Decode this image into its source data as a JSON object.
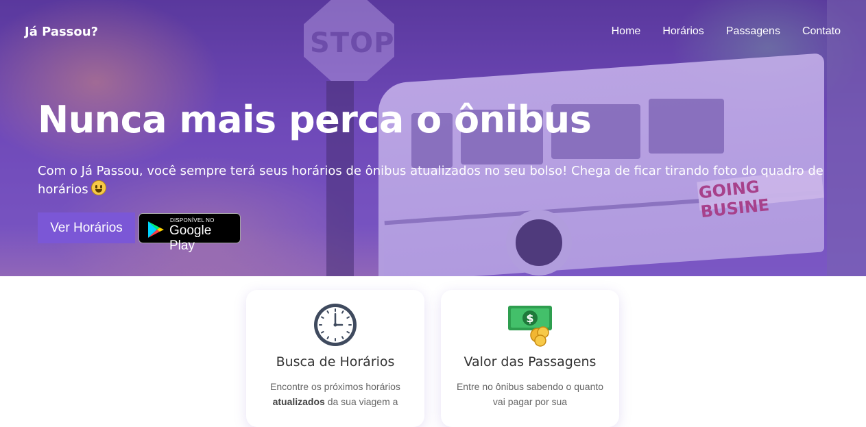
{
  "brand": "Já Passou?",
  "nav": {
    "items": [
      "Home",
      "Horários",
      "Passagens",
      "Contato"
    ]
  },
  "hero": {
    "title": "Nunca mais perca o ônibus",
    "subtitle": "Com o Já Passou, você sempre terá seus horários de ônibus atualizados no seu bolso! Chega de ficar tirando foto do quadro de horários",
    "emoji_icon": "grinning-face-icon",
    "cta_label": "Ver Horários",
    "store_badge": {
      "small": "DISPONÍVEL NO",
      "big": "Google Play"
    },
    "background_text": {
      "stop": "STOP",
      "bus_sign": "GOING BUSINE"
    }
  },
  "cards": [
    {
      "icon": "clock-icon",
      "title": "Busca de Horários",
      "text_before": "Encontre os próximos horários ",
      "text_bold": "atualizados",
      "text_after": " da sua viagem a"
    },
    {
      "icon": "money-icon",
      "title": "Valor das Passagens",
      "text": "Entre no ônibus sabendo o quanto vai pagar por sua"
    }
  ],
  "colors": {
    "accent": "#7b57d6",
    "hero_tint": "#6a46b0"
  }
}
